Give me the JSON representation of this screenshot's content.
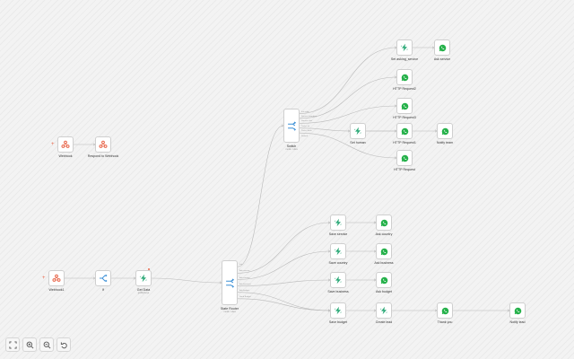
{
  "nodes": {
    "webhook": {
      "label": "Webhook",
      "icon": "webhook-icon"
    },
    "respond_to_webhook": {
      "label": "Respond to Webhook",
      "icon": "webhook-icon"
    },
    "webhook1": {
      "label": "Webhook1",
      "icon": "webhook-icon"
    },
    "if": {
      "label": "If",
      "icon": "if-branch-icon"
    },
    "get_data": {
      "label": "Get Data",
      "sub": "getByKeys",
      "icon": "lightning-icon"
    },
    "state_router": {
      "label": "State Router",
      "sub": "mode: rules",
      "icon": "switch-icon",
      "outputs": [
        "Init",
        "Ask service",
        "Ask country",
        "Ask business",
        "Ask budget",
        "Send Budget"
      ]
    },
    "switch": {
      "label": "Switch",
      "sub": "mode: rules",
      "icon": "switch-icon",
      "outputs": [
        "Init salon",
        "Service: branding",
        "Service: dev",
        "Tasks: ok",
        "Tasks: book",
        "Default"
      ]
    },
    "set_asking_service": {
      "label": "Set asking_service",
      "icon": "lightning-icon"
    },
    "ask_service": {
      "label": "Ask service",
      "icon": "whatsapp-icon"
    },
    "http_request2": {
      "label": "HTTP Request2",
      "icon": "whatsapp-icon"
    },
    "http_request3": {
      "label": "HTTP Request3",
      "icon": "whatsapp-icon"
    },
    "set_human": {
      "label": "Set human",
      "icon": "lightning-icon"
    },
    "http_request1": {
      "label": "HTTP Request1",
      "icon": "whatsapp-icon"
    },
    "notify_team": {
      "label": "Notify team",
      "icon": "whatsapp-icon"
    },
    "http_request": {
      "label": "HTTP Request",
      "icon": "whatsapp-icon"
    },
    "save_service": {
      "label": "Save service",
      "icon": "lightning-icon"
    },
    "ask_country": {
      "label": "Ask country",
      "icon": "whatsapp-icon"
    },
    "save_country": {
      "label": "Save country",
      "icon": "lightning-icon"
    },
    "ask_business": {
      "label": "Ask business",
      "icon": "whatsapp-icon"
    },
    "save_business": {
      "label": "Save business",
      "icon": "lightning-icon"
    },
    "ask_budget": {
      "label": "Ask budget",
      "icon": "whatsapp-icon"
    },
    "save_budget": {
      "label": "Save budget",
      "icon": "lightning-icon"
    },
    "create_lead": {
      "label": "Create lead",
      "icon": "lightning-icon"
    },
    "thank_you": {
      "label": "Thank you",
      "icon": "whatsapp-icon"
    },
    "notify_lead": {
      "label": "Notify lead",
      "icon": "whatsapp-icon"
    }
  },
  "toolbar": {
    "buttons": [
      "fit-view-icon",
      "zoom-in-icon",
      "zoom-out-icon",
      "reset-zoom-icon"
    ]
  },
  "colors": {
    "webhook": "#e8664a",
    "lightning": "#2aa876",
    "whatsapp": "#25b14a",
    "switch": "#3a8fd6",
    "if": "#3a8fd6",
    "edge": "#b9b9b9"
  }
}
